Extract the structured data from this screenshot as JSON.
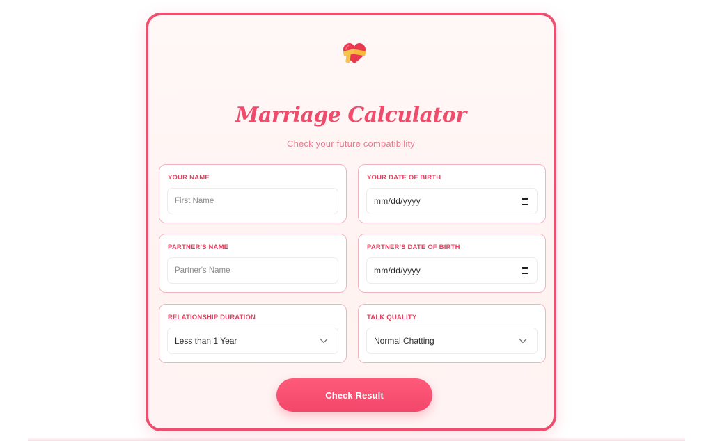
{
  "app": {
    "logo_icon": "heart-with-bandage-icon",
    "title": "Marriage Calculator",
    "subtitle": "Check your future compatibility"
  },
  "form": {
    "your_name": {
      "label": "YOUR NAME",
      "placeholder": "First Name",
      "value": ""
    },
    "your_dob": {
      "label": "YOUR DATE OF BIRTH",
      "value": "mm/dd/yyyy",
      "icon": "calendar-icon"
    },
    "partner_name": {
      "label": "PARTNER'S NAME",
      "placeholder": "Partner's Name",
      "value": ""
    },
    "partner_dob": {
      "label": "PARTNER'S DATE OF BIRTH",
      "value": "mm/dd/yyyy",
      "icon": "calendar-icon"
    },
    "relationship_duration": {
      "label": "RELATIONSHIP DURATION",
      "selected": "Less than 1 Year",
      "icon": "chevron-down-icon"
    },
    "talk_quality": {
      "label": "TALK QUALITY",
      "selected": "Normal Chatting",
      "icon": "chevron-down-icon"
    },
    "submit_label": "Check Result"
  },
  "colors": {
    "accent": "#ee4f6f",
    "label": "#e4405f",
    "subtitle": "#e77a8e",
    "field_border": "#f0b4bf",
    "card_bg": "#fff5f4"
  }
}
